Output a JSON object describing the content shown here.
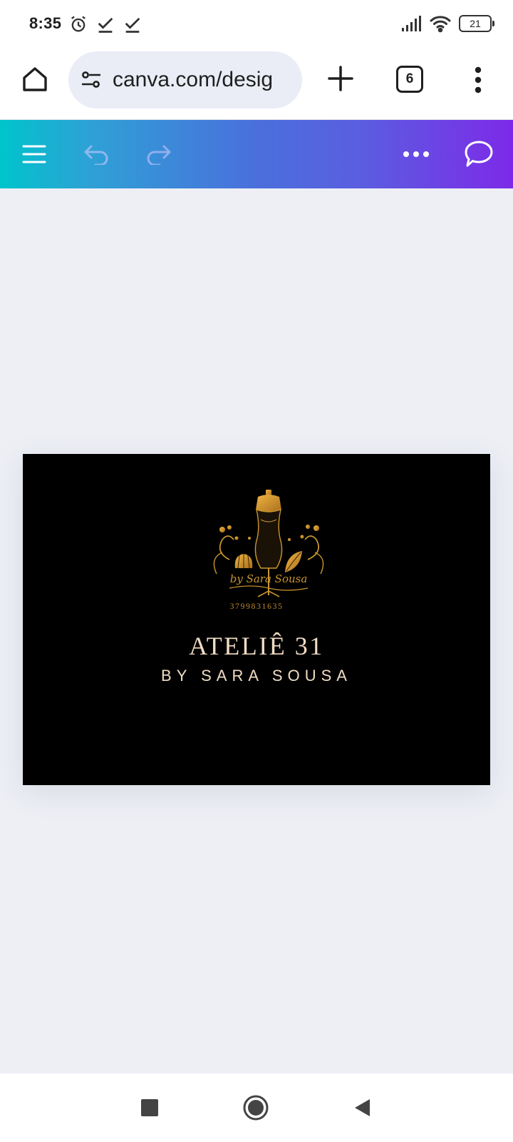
{
  "status_bar": {
    "time": "8:35",
    "battery": "21",
    "icons": [
      "alarm-icon",
      "check-icon",
      "check-icon",
      "signal-icon",
      "wifi-icon",
      "battery-icon"
    ]
  },
  "browser": {
    "url": "canva.com/desig",
    "tab_count": "6",
    "icons": [
      "home-icon",
      "site-settings-icon",
      "plus-icon",
      "tabs-icon",
      "more-vert-icon"
    ]
  },
  "canva_toolbar": {
    "icons": [
      "hamburger-menu-icon",
      "undo-icon",
      "redo-icon",
      "more-horiz-icon",
      "comment-icon"
    ]
  },
  "design": {
    "logo_script": "by Sara Sousa",
    "logo_phone": "3799831635",
    "title": "ATELIÊ 31",
    "subtitle": "BY SARA SOUSA",
    "colors": {
      "background": "#000000",
      "gold": "#c9952e",
      "text": "#f0dcc4"
    }
  },
  "nav_bar": {
    "icons": [
      "recents-square-icon",
      "home-circle-icon",
      "back-triangle-icon"
    ]
  }
}
